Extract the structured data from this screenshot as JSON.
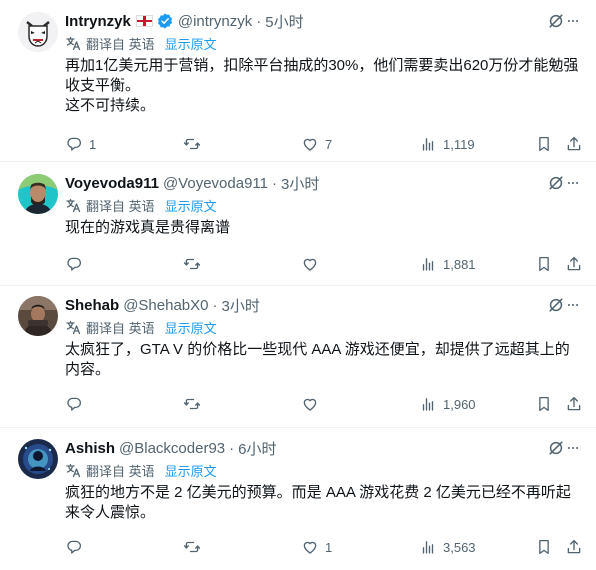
{
  "tweets": [
    {
      "name": "Intrynzyk",
      "handle": "@intrynzyk",
      "time": "5小时",
      "translate_label": "翻译自 英语",
      "show_original": "显示原文",
      "text": "再加1亿美元用于营销，扣除平台抽成的30%，他们需要卖出620万份才能勉强\n收支平衡。\n这不可持续。",
      "replies": "1",
      "retweets": "",
      "likes": "7",
      "views": "1,119"
    },
    {
      "name": "Voyevoda911",
      "handle": "@Voyevoda911",
      "time": "3小时",
      "translate_label": "翻译自 英语",
      "show_original": "显示原文",
      "text": "现在的游戏真是贵得离谱",
      "replies": "",
      "retweets": "",
      "likes": "",
      "views": "1,881"
    },
    {
      "name": "Shehab",
      "handle": "@ShehabX0",
      "time": "3小时",
      "translate_label": "翻译自 英语",
      "show_original": "显示原文",
      "text": "太疯狂了，GTA V 的价格比一些现代 AAA 游戏还便宜，却提供了远超其上的\n内容。",
      "replies": "",
      "retweets": "",
      "likes": "",
      "views": "1,960"
    },
    {
      "name": "Ashish",
      "handle": "@Blackcoder93",
      "time": "6小时",
      "translate_label": "翻译自 英语",
      "show_original": "显示原文",
      "text": "疯狂的地方不是 2 亿美元的预算。而是 AAA 游戏花费 2 亿美元已经不再听起\n来令人震惊。",
      "replies": "",
      "retweets": "",
      "likes": "1",
      "views": "3,563"
    }
  ],
  "separator": "·",
  "colors": {
    "accent": "#1d9bf0",
    "secondary": "#536471",
    "text": "#0f1419",
    "flag_red": "#cf142b"
  }
}
